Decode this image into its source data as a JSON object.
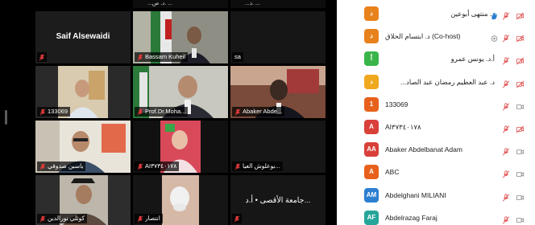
{
  "gallery": {
    "tiles": [
      {
        "id": "t1",
        "name": "",
        "top_text": "...د. ص. ...",
        "muted": false
      },
      {
        "id": "t2",
        "name": "",
        "top_text": "...د. ...",
        "muted": false
      },
      {
        "id": "t3",
        "name": "Saif Alsewaidi",
        "muted": true
      },
      {
        "id": "t4",
        "name": "Bassam Kuheil",
        "muted": true
      },
      {
        "id": "t5",
        "name": "sa",
        "muted": false
      },
      {
        "id": "t6",
        "name": "133069",
        "muted": true
      },
      {
        "id": "t7",
        "name": "Prof.Dr.Moha...",
        "muted": true
      },
      {
        "id": "t8",
        "name": "Abaker Abde...",
        "muted": true
      },
      {
        "id": "t9",
        "name": "ياسين صدوقي",
        "muted": true
      },
      {
        "id": "t10",
        "name": "AI۳۷۳٤٠١٧٨",
        "muted": true
      },
      {
        "id": "t11",
        "name": "بوعلوش العيا...",
        "muted": true
      },
      {
        "id": "t12",
        "name": "كوثلي نورالدين",
        "muted": true
      },
      {
        "id": "t13",
        "name": "انتصار",
        "muted": true
      },
      {
        "id": "t14",
        "name": "جامعة الأقصى • أ.د...",
        "muted": true
      }
    ]
  },
  "participants": [
    {
      "initial": "د",
      "color": "#e8821c",
      "name": "د. منتهى أبوعين",
      "rtl": true,
      "hand": true,
      "cam": false
    },
    {
      "initial": "د",
      "color": "#e8821c",
      "name": "د. ابتسام الحلاق (Co-host)",
      "rtl": false,
      "hand": false,
      "cam": true
    },
    {
      "initial": "أ",
      "color": "#3ab54a",
      "name": "أ.د. يونس عمرو",
      "rtl": true,
      "hand": false,
      "cam": false
    },
    {
      "initial": "د",
      "color": "#f0a81e",
      "name": "د. عبد العظيم رمضان عبد الصاد...",
      "rtl": true,
      "hand": false,
      "cam": false
    },
    {
      "initial": "1",
      "color": "#e8611c",
      "name": "133069",
      "rtl": false,
      "hand": false,
      "cam": false
    },
    {
      "initial": "A",
      "color": "#d9403a",
      "name": "AI۳۷۳٤٠١٧٨",
      "rtl": false,
      "hand": false,
      "cam": false
    },
    {
      "initial": "AA",
      "color": "#d9403a",
      "name": "Abaker Abdelbanat Adam",
      "rtl": false,
      "hand": false,
      "cam": false
    },
    {
      "initial": "A",
      "color": "#e8611c",
      "name": "ABC",
      "rtl": false,
      "hand": false,
      "cam": false
    },
    {
      "initial": "AM",
      "color": "#2d7fd1",
      "name": "Abdelghani MILIANI",
      "rtl": false,
      "hand": false,
      "cam": false
    },
    {
      "initial": "AF",
      "color": "#26a69a",
      "name": "Abdelrazag Faraj",
      "rtl": false,
      "hand": false,
      "cam": false
    }
  ]
}
